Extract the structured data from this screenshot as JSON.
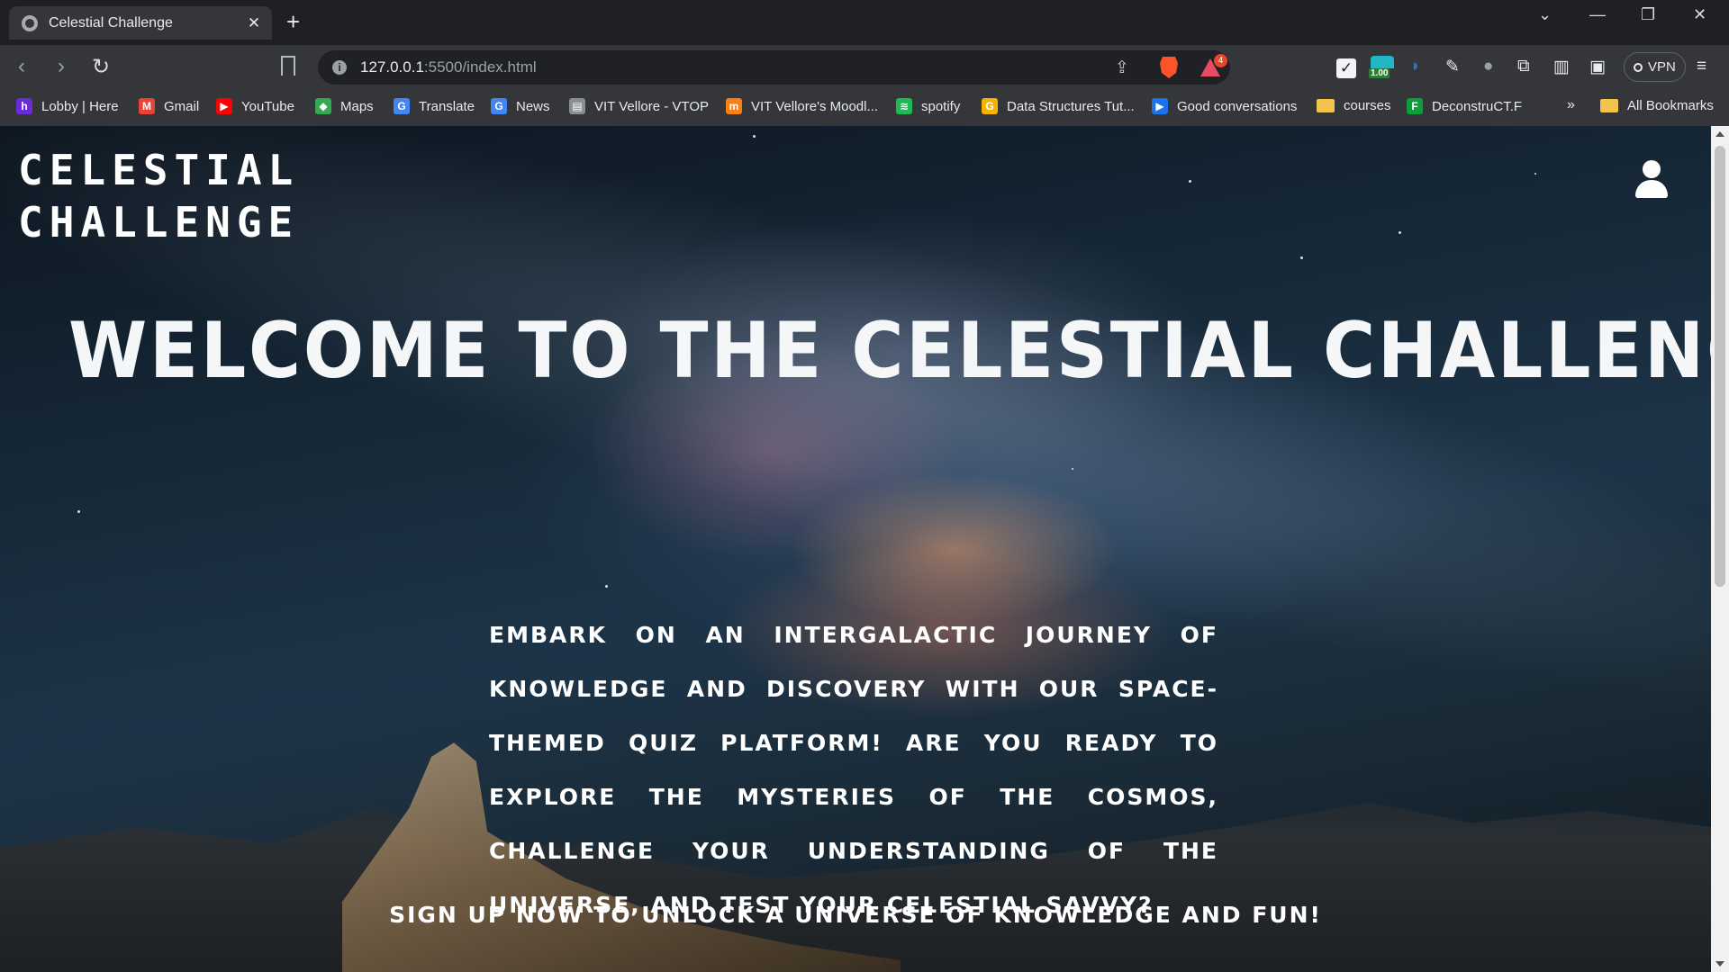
{
  "browser": {
    "tab_title": "Celestial Challenge",
    "tab_close": "✕",
    "new_tab": "+",
    "window_controls": {
      "menu": "⌄",
      "minimize": "—",
      "restore": "❐",
      "close": "✕"
    },
    "nav": {
      "back": "‹",
      "forward": "›",
      "reload": "↻"
    },
    "url_host": "127.0.0.1",
    "url_path": ":5500/index.html",
    "site_info_icon": "i",
    "rewards_badge": "4",
    "extension_score": "1.00",
    "vpn_label": "VPN",
    "bookmarks": [
      {
        "label": "Lobby | Here",
        "icon": "h",
        "color": "#6a2bd9"
      },
      {
        "label": "Gmail",
        "icon": "M",
        "color": "#ea4335"
      },
      {
        "label": "YouTube",
        "icon": "▶",
        "color": "#ff0000"
      },
      {
        "label": "Maps",
        "icon": "◆",
        "color": "#34a853"
      },
      {
        "label": "Translate",
        "icon": "G",
        "color": "#4285f4"
      },
      {
        "label": "News",
        "icon": "G",
        "color": "#4285f4"
      },
      {
        "label": "VIT Vellore - VTOP",
        "icon": "▤",
        "color": "#8a8d91"
      },
      {
        "label": "VIT Vellore's Moodl...",
        "icon": "m",
        "color": "#f98012"
      },
      {
        "label": "spotify",
        "icon": "≋",
        "color": "#1db954"
      },
      {
        "label": "Data Structures Tut...",
        "icon": "G",
        "color": "#f4b400"
      },
      {
        "label": "Good conversations",
        "icon": "▶",
        "color": "#1a73e8"
      },
      {
        "label": "courses",
        "icon": "",
        "color": "#f2c34d"
      },
      {
        "label": "DeconstruCT.F",
        "icon": "F",
        "color": "#0b9e3b"
      }
    ],
    "bookmarks_more": "»",
    "all_bookmarks": "All Bookmarks"
  },
  "page": {
    "logo_line1": "CELESTIAL",
    "logo_line2": "CHALLENGE",
    "hero_title": "WELCOME TO THE CELESTIAL CHALLENGE !!!",
    "intro": "Embark on an intergalactic journey of knowledge and discovery with our space-themed quiz platform! Are you ready to explore the mysteries of the cosmos, challenge your understanding of the universe, and test your celestial savvy?",
    "cta": "Sign up now to unlock a universe of knowledge and fun!"
  },
  "colors": {
    "chrome_dark": "#1f2023",
    "chrome_toolbar": "#35363a",
    "text_white": "#ffffff"
  }
}
